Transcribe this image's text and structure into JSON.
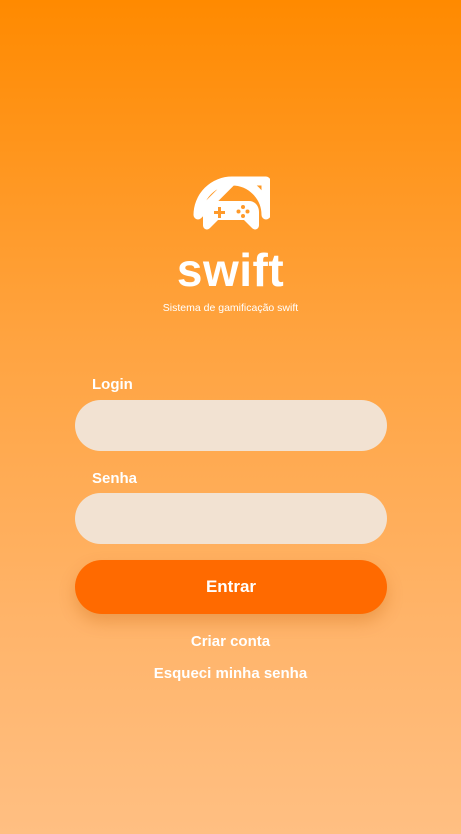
{
  "brand": {
    "name": "swift",
    "tagline": "Sistema de gamificação swift",
    "logo_icon": "gamepad-icon"
  },
  "form": {
    "login_label": "Login",
    "login_value": "",
    "password_label": "Senha",
    "password_value": "",
    "submit_label": "Entrar"
  },
  "links": {
    "create_account": "Criar conta",
    "forgot_password": "Esqueci minha senha"
  },
  "colors": {
    "background_top": "#ff8a00",
    "background_bottom": "#ffbf82",
    "input_background": "#f2e2d2",
    "button": "#ff6a00",
    "text": "#ffffff"
  }
}
